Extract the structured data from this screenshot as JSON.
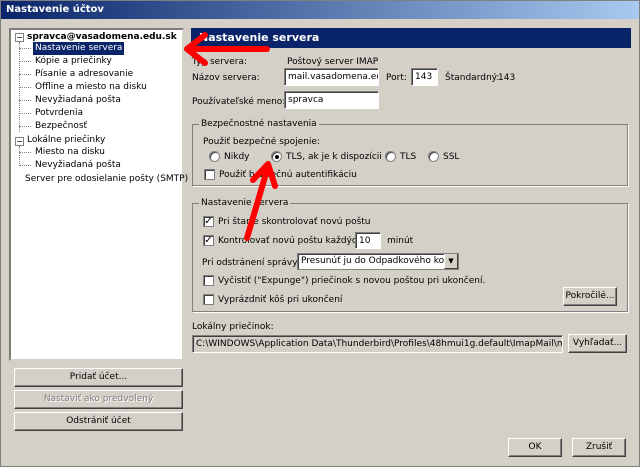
{
  "window": {
    "title": "Nastavenie účtov"
  },
  "tree": {
    "account": "spravca@vasadomena.edu.sk",
    "account_items": [
      "Nastavenie servera",
      "Kópie a priečinky",
      "Písanie a adresovanie",
      "Offline a miesto na disku",
      "Nevyžiadaná pošta",
      "Potvrdenia",
      "Bezpečnosť"
    ],
    "local": "Lokálne priečinky",
    "local_items": [
      "Miesto na disku",
      "Nevyžiadaná pošta"
    ],
    "smtp": "Server pre odosielanie pošty (SMTP)"
  },
  "left_buttons": {
    "add": "Pridať účet...",
    "default": "Nastaviť ako predvolený",
    "remove": "Odstrániť účet"
  },
  "panel": {
    "header": "Nastavenie servera",
    "type_label": "Typ servera:",
    "type_value": "Poštový server IMAP",
    "server_label": "Názov servera:",
    "server_value": "mail.vasadomena.edu.",
    "port_label": "Port:",
    "port_value": "143",
    "default_label": "Štandardný:",
    "default_value": "143",
    "user_label": "Používateľské meno:",
    "user_value": "spravca"
  },
  "security": {
    "title": "Bezpečnostné nastavenia",
    "use_secure": "Použiť bezpečné spojenie:",
    "options": [
      "Nikdy",
      "TLS, ak je k dispozícii",
      "TLS",
      "SSL"
    ],
    "selected": "TLS, ak je k dispozícii",
    "secure_auth": "Použiť bezpečnú autentifikáciu"
  },
  "server_settings": {
    "title": "Nastavenie servera",
    "check_startup": "Pri štarte skontrolovať novú poštu",
    "check_every": "Kontrolovať novú poštu každých",
    "minutes_value": "10",
    "minutes_label": "minút",
    "on_delete_label": "Pri odstránení správy:",
    "on_delete_value": "Presunúť ju do Odpadkového koša",
    "expunge": "Vyčistiť (\"Expunge\") priečinok s novou poštou pri ukončení.",
    "empty_trash": "Vyprázdniť kôš pri ukončení",
    "advanced": "Pokročilé..."
  },
  "local_folder": {
    "label": "Lokálny priečinok:",
    "path": "C:\\WINDOWS\\Application Data\\Thunderbird\\Profiles\\48hmui1g.default\\ImapMail\\mail.vasadomena",
    "browse": "Vyhľadať..."
  },
  "dialog": {
    "ok": "OK",
    "cancel": "Zrušiť"
  },
  "colors": {
    "selection": "#0a246a",
    "annotation_arrow": "#ff0000"
  }
}
